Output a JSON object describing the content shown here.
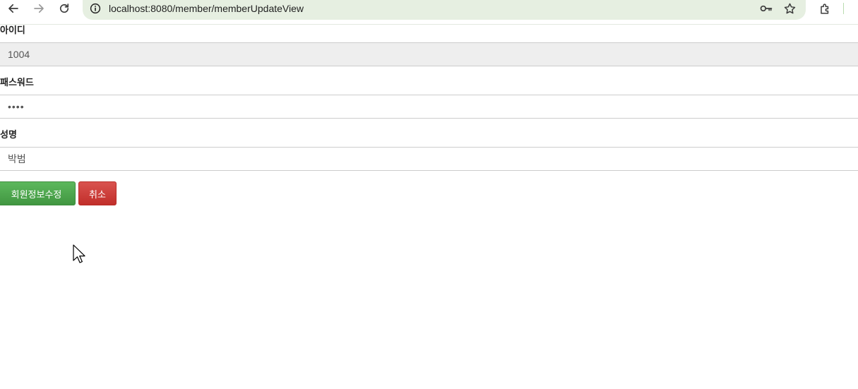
{
  "browser": {
    "url": "localhost:8080/member/memberUpdateView",
    "icons": {
      "back": "arrow-left-icon",
      "forward": "arrow-right-icon",
      "reload": "reload-icon",
      "site_info": "info-icon",
      "password_manager": "key-icon",
      "bookmark": "star-icon",
      "extensions": "puzzle-icon"
    },
    "colors": {
      "omnibox_bg": "#e6efe1"
    }
  },
  "form": {
    "id_label": "아이디",
    "id_value": "1004",
    "password_label": "패스워드",
    "password_value": "••••",
    "name_label": "성명",
    "name_value": "박범"
  },
  "buttons": {
    "submit_label": "회원정보수정",
    "cancel_label": "취소"
  },
  "colors": {
    "submit": "#5cb85c",
    "cancel": "#d9534f"
  }
}
